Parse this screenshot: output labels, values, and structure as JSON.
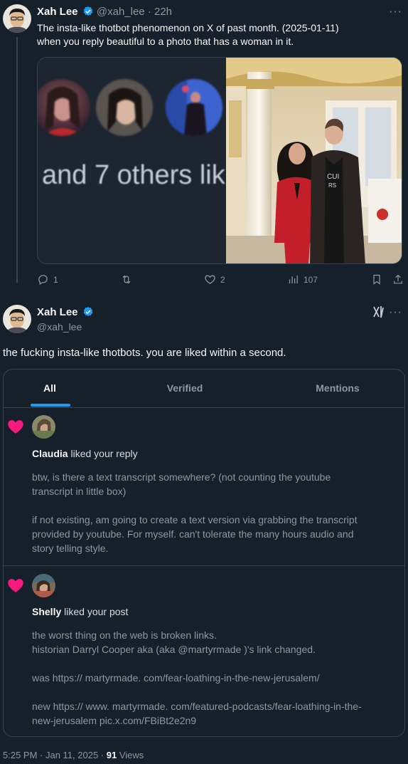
{
  "tweet1": {
    "author_name": "Xah Lee",
    "handle": "@xah_lee",
    "time": "22h",
    "text_line1": "The insta-like thotbot phenomenon on X of past month. (2025-01-11)",
    "text_line2": "when you reply beautiful to a photo that has a woman in it.",
    "media_left_text": "and 7 others lik",
    "actions": {
      "replies": "1",
      "retweets": "",
      "likes": "2",
      "views": "107"
    }
  },
  "tweet2": {
    "author_name": "Xah Lee",
    "handle": "@xah_lee",
    "text": "the fucking insta-like thotbots. you are liked within a second.",
    "embedded": {
      "tabs": [
        "All",
        "Verified",
        "Mentions"
      ],
      "active_tab": "All",
      "notifications": [
        {
          "user": "Claudia",
          "action": "liked your reply",
          "lines": [
            "btw, is there a text transcript somewhere? (not counting the youtube",
            "transcript in little box)",
            "if not existing, am going to create a text version via grabbing the transcript",
            "provided by youtube. For myself. can't tolerate the many hours audio and",
            "story telling style."
          ]
        },
        {
          "user": "Shelly",
          "action": "liked your post",
          "lines": [
            "the worst thing on the web is broken links.",
            "historian Darryl Cooper aka (aka @martyrmade )'s link changed.",
            "was https:// martyrmade. com/fear-loathing-in-the-new-jerusalem/",
            "new https:// www. martyrmade. com/featured-podcasts/fear-loathing-in-the-",
            "new-jerusalem pic.x.com/FBiBt2e2n9"
          ]
        }
      ]
    },
    "timestamp": "5:25 PM · Jan 11, 2025 ·",
    "views_count": "91",
    "views_label": "Views"
  },
  "colors": {
    "background": "#15202b",
    "accent": "#1d9bf0",
    "heart": "#f91880",
    "muted_text": "#8b98a5",
    "border": "#38444d"
  },
  "icons": [
    "verified-badge-icon",
    "more-icon",
    "reply-icon",
    "retweet-icon",
    "like-icon",
    "views-icon",
    "bookmark-icon",
    "share-icon",
    "grok-icon",
    "heart-icon"
  ]
}
